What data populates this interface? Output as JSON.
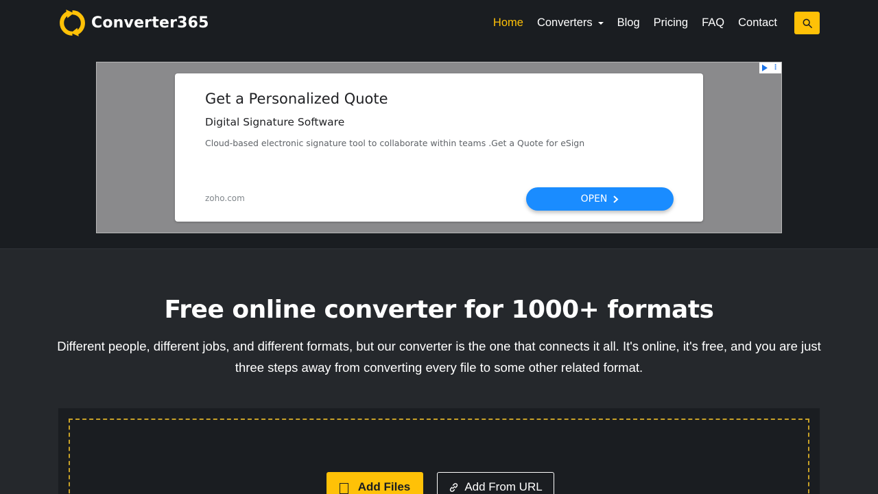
{
  "brand": {
    "name": "Converter365",
    "accent_color": "#ffc107",
    "logo_icon": "refresh-arrows-logo-icon"
  },
  "nav": {
    "items": [
      {
        "label": "Home",
        "active": true
      },
      {
        "label": "Converters",
        "dropdown": true
      },
      {
        "label": "Blog"
      },
      {
        "label": "Pricing"
      },
      {
        "label": "FAQ"
      },
      {
        "label": "Contact"
      }
    ],
    "search_icon": "search-icon"
  },
  "ad": {
    "title": "Get a Personalized Quote",
    "subtitle": "Digital Signature Software",
    "description": "Cloud-based electronic signature tool to collaborate within teams .Get a Quote for eSign",
    "domain": "zoho.com",
    "cta": "OPEN"
  },
  "hero": {
    "title": "Free online converter for 1000+ formats",
    "description": "Different people, different jobs, and different formats, but our converter is the one that connects it all. It's online, it's free, and you are just three steps away from converting every file to some other related format."
  },
  "upload": {
    "add_files_label": "Add Files",
    "add_url_label": "Add From URL"
  }
}
